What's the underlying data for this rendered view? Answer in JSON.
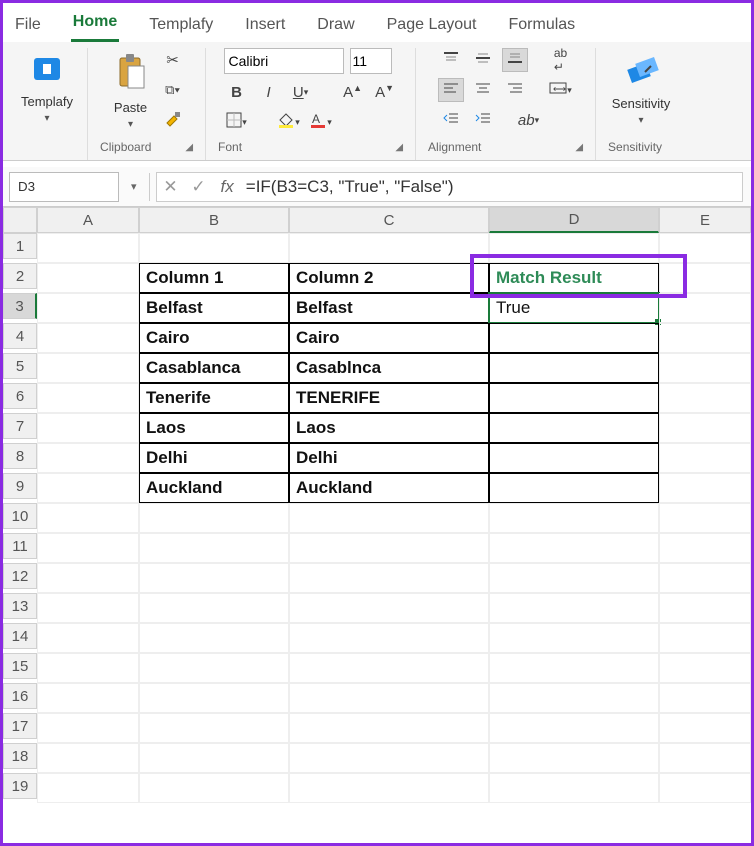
{
  "tabs": [
    "File",
    "Home",
    "Templafy",
    "Insert",
    "Draw",
    "Page Layout",
    "Formulas"
  ],
  "activeTab": "Home",
  "ribbon": {
    "templafy": {
      "label": "Templafy"
    },
    "clipboard": {
      "paste": "Paste",
      "group": "Clipboard"
    },
    "font": {
      "name": "Calibri",
      "size": "11",
      "group": "Font"
    },
    "alignment": {
      "group": "Alignment"
    },
    "sensitivity": {
      "label": "Sensitivity",
      "group": "Sensitivity"
    }
  },
  "nameBox": "D3",
  "formula": "=IF(B3=C3, \"True\", \"False\")",
  "columns": [
    "A",
    "B",
    "C",
    "D",
    "E"
  ],
  "rows": [
    "1",
    "2",
    "3",
    "4",
    "5",
    "6",
    "7",
    "8",
    "9",
    "10",
    "11",
    "12",
    "13",
    "14",
    "15",
    "16",
    "17",
    "18",
    "19"
  ],
  "selectedCol": "D",
  "selectedRow": "3",
  "table": {
    "headers": {
      "b": "Column 1",
      "c": "Column 2",
      "d": "Match Result"
    },
    "data": [
      {
        "b": "Belfast",
        "c": "Belfast",
        "d": "True"
      },
      {
        "b": "Cairo",
        "c": "Cairo",
        "d": ""
      },
      {
        "b": "Casablanca",
        "c": "Casablnca",
        "d": ""
      },
      {
        "b": "Tenerife",
        "c": "TENERIFE",
        "d": ""
      },
      {
        "b": "Laos",
        "c": "Laos",
        "d": ""
      },
      {
        "b": "Delhi",
        "c": "Delhi",
        "d": ""
      },
      {
        "b": "Auckland",
        "c": "Auckland",
        "d": ""
      }
    ]
  }
}
